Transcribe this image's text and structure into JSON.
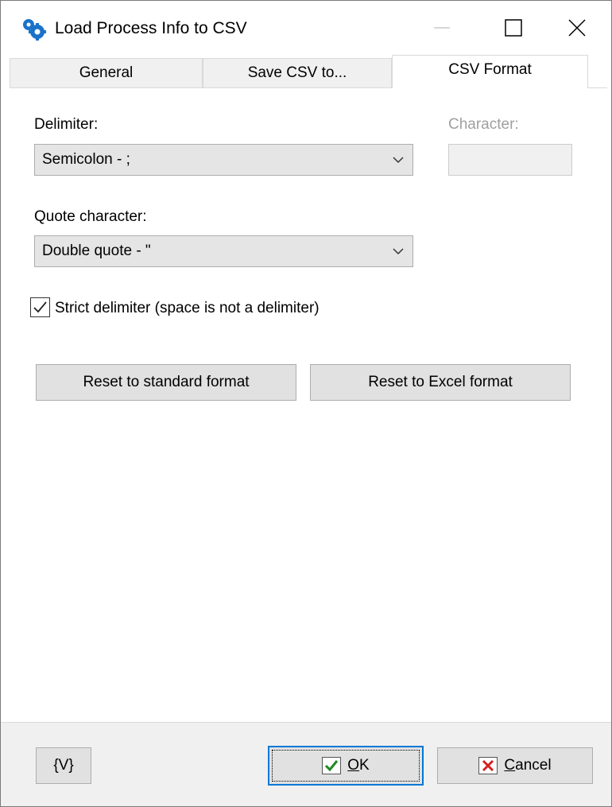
{
  "window": {
    "title": "Load Process Info to CSV"
  },
  "tabs": [
    {
      "label": "General",
      "active": false
    },
    {
      "label": "Save CSV to...",
      "active": false
    },
    {
      "label": "CSV Format",
      "active": true
    }
  ],
  "form": {
    "delimiter_label": "Delimiter:",
    "delimiter_value": "Semicolon - ;",
    "character_label": "Character:",
    "character_value": "",
    "quote_label": "Quote character:",
    "quote_value": "Double quote - \"",
    "strict_checkbox_label": "Strict delimiter (space is not a delimiter)",
    "strict_checked": true,
    "reset_standard_label": "Reset to standard format",
    "reset_excel_label": "Reset to Excel format"
  },
  "footer": {
    "variables_label": "{V}",
    "ok_label": "OK",
    "ok_mnemonic": "O",
    "ok_rest": "K",
    "cancel_label": "Cancel",
    "cancel_mnemonic": "C",
    "cancel_rest": "ancel"
  },
  "colors": {
    "accent": "#0078d7",
    "ok_check": "#1e8a1e",
    "cancel_x": "#d42020",
    "app_icon_blue": "#1a73c9"
  },
  "icons": {
    "app": "gears-icon",
    "minimize": "minimize-icon",
    "maximize": "maximize-icon",
    "close": "close-icon",
    "dropdown": "chevron-down-icon",
    "check": "check-icon",
    "ok": "green-check-icon",
    "cancel": "red-x-icon"
  }
}
